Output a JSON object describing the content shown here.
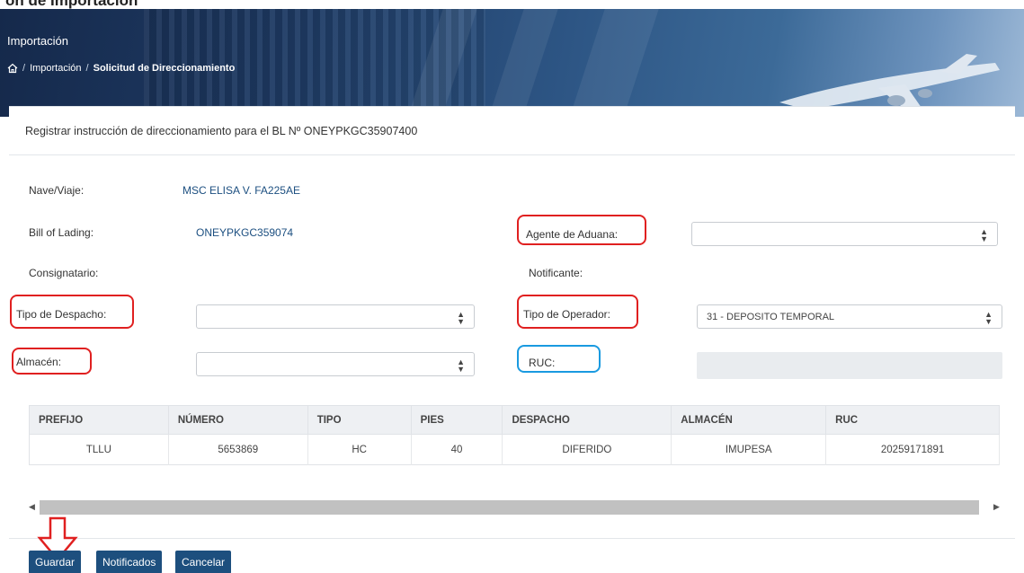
{
  "top_peek": "ón de Importación",
  "header": {
    "title": "Importación",
    "breadcrumb": [
      "Importación",
      "Solicitud de Direccionamiento"
    ]
  },
  "card": {
    "title": "Registrar instrucción de direccionamiento para el BL Nº ONEYPKGC35907400"
  },
  "form": {
    "nave_label": "Nave/Viaje:",
    "nave_value": "MSC ELISA V. FA225AE",
    "bl_label": "Bill of Lading:",
    "bl_value": "ONEYPKGC359074",
    "agente_label": "Agente de Aduana:",
    "agente_value": "",
    "consignatario_label": "Consignatario:",
    "notificante_label": "Notificante:",
    "tipo_despacho_label": "Tipo de Despacho:",
    "tipo_despacho_value": "",
    "tipo_operador_label": "Tipo de Operador:",
    "tipo_operador_value": "31 - DEPOSITO TEMPORAL",
    "almacen_label": "Almacén:",
    "almacen_value": "",
    "ruc_label": "RUC:",
    "ruc_value": ""
  },
  "table": {
    "columns": [
      "PREFIJO",
      "NÚMERO",
      "TIPO",
      "PIES",
      "DESPACHO",
      "ALMACÉN",
      "RUC"
    ],
    "rows": [
      [
        "TLLU",
        "5653869",
        "HC",
        "40",
        "DIFERIDO",
        "IMUPESA",
        "20259171891"
      ]
    ]
  },
  "buttons": {
    "guardar": "Guardar",
    "notificados": "Notificados",
    "cancelar": "Cancelar"
  },
  "colors": {
    "primary_button": "#1d4f7e",
    "link_value": "#1c4f80",
    "annotation_red": "#e02020",
    "annotation_blue": "#1a9ae0"
  }
}
